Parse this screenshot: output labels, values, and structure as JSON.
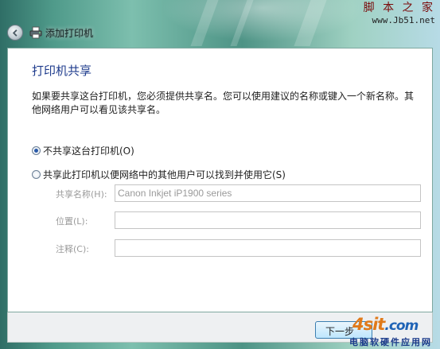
{
  "watermark_top": {
    "title": "脚 本 之 家",
    "url": "www.Jb51.net"
  },
  "window": {
    "title": "添加打印机"
  },
  "page": {
    "title": "打印机共享",
    "description": "如果要共享这台打印机，您必须提供共享名。您可以使用建议的名称或键入一个新名称。其他网络用户可以看见该共享名。"
  },
  "options": {
    "no_share": {
      "label": "不共享这台打印机(O)",
      "selected": true
    },
    "share": {
      "label": "共享此打印机以便网络中的其他用户可以找到并使用它(S)",
      "selected": false
    }
  },
  "fields": {
    "share_name": {
      "label": "共享名称(H):",
      "value": "Canon Inkjet iP1900 series"
    },
    "location": {
      "label": "位置(L):",
      "value": ""
    },
    "comment": {
      "label": "注释(C):",
      "value": ""
    }
  },
  "buttons": {
    "next": "下一步"
  },
  "watermark_bottom": {
    "logo": "4sit",
    "logo_suffix": ".com",
    "subtitle": "电脑软硬件应用网"
  }
}
